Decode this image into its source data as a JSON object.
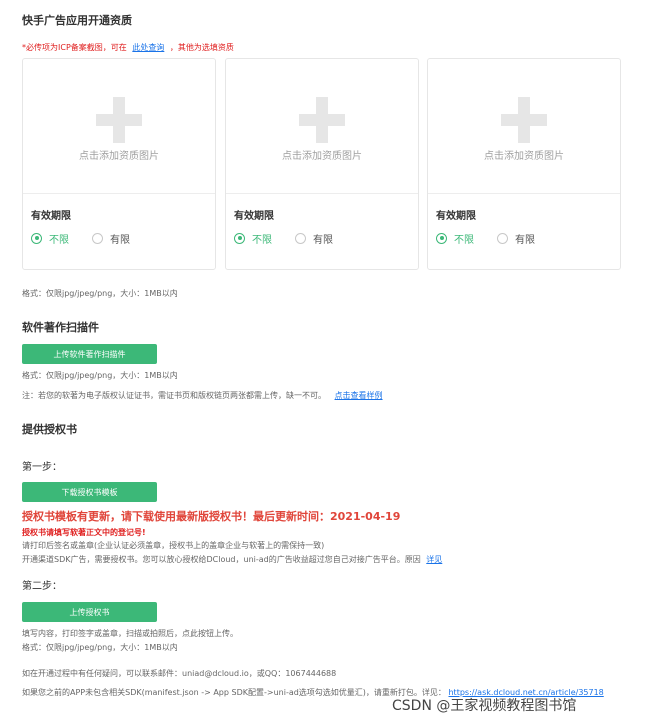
{
  "section1": {
    "title": "快手广告应用开通资质",
    "note_prefix": "*必传项为ICP备案截图，可在",
    "note_link": "此处查询",
    "note_suffix": "，其他为选填资质"
  },
  "cards": [
    {
      "upload_text": "点击添加资质图片",
      "validity_label": "有效期限",
      "opt_unlimited": "不限",
      "opt_limited": "有限"
    },
    {
      "upload_text": "点击添加资质图片",
      "validity_label": "有效期限",
      "opt_unlimited": "不限",
      "opt_limited": "有限"
    },
    {
      "upload_text": "点击添加资质图片",
      "validity_label": "有效期限",
      "opt_unlimited": "不限",
      "opt_limited": "有限"
    }
  ],
  "format_note": "格式：仅限jpg/jpeg/png，大小：1MB以内",
  "section2": {
    "title": "软件著作扫描件",
    "button": "上传软件著作扫描件",
    "format_note": "格式：仅限jpg/jpeg/png，大小：1MB以内",
    "remark": "注：若您的软著为电子版权认证证书，需证书页和版权链页两张都需上传，缺一不可。",
    "remark_link": "点击查看样例"
  },
  "section3": {
    "title": "提供授权书",
    "step1": "第一步：",
    "download_button": "下载授权书模板",
    "warning_big": "授权书模板有更新，请下载使用最新版授权书！最后更新时间：2021-04-19",
    "warning_small": "授权书请填写软著正文中的登记号!",
    "line1": "请打印后签名或盖章(企业认证必须盖章，授权书上的盖章企业与软著上的需保持一致)",
    "line2_prefix": "开通渠道SDK广告，需要授权书。您可以放心授权给DCloud，uni-ad的广告收益超过您自己对接广告平台。原因",
    "line2_link": "详见",
    "step2": "第二步：",
    "upload_button": "上传授权书",
    "upload_note": "填写内容，打印签字或盖章，扫描或拍照后，点此按钮上传。",
    "format_note": "格式：仅限jpg/jpeg/png，大小：1MB以内"
  },
  "footer": {
    "contact": "如在开通过程中有任何疑问，可以联系邮件：uniad@dcloud.io，或QQ：1067444688",
    "sdk_prefix": "如果您之前的APP未包含相关SDK(manifest.json -> App SDK配置->uni-ad选项勾选如优量汇)，请重新打包。详见：",
    "sdk_link": "https://ask.dcloud.net.cn/article/35718",
    "watermark": "CSDN @王家视频教程图书馆"
  }
}
